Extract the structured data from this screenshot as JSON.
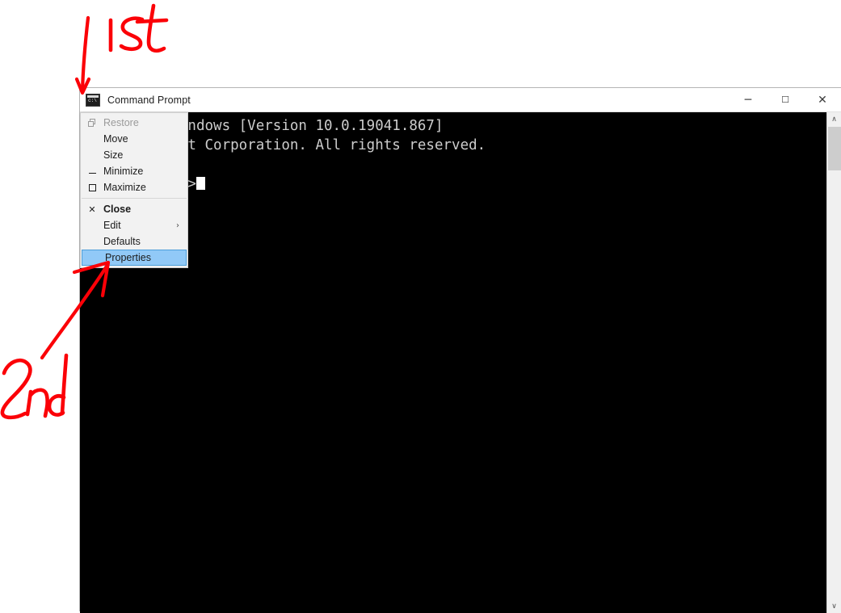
{
  "window": {
    "title": "Command Prompt",
    "app_icon": "command-prompt-icon",
    "caption_buttons": [
      {
        "name": "minimize",
        "glyph": "─"
      },
      {
        "name": "maximize",
        "glyph": "☐"
      },
      {
        "name": "close",
        "glyph": "✕"
      }
    ]
  },
  "console": {
    "lines": [
      "Microsoft Windows [Version 10.0.19041.867]",
      "(c) Microsoft Corporation. All rights reserved.",
      "",
      "C:\\Users\\edd>"
    ],
    "background_color": "#000000",
    "text_color": "#cccccc",
    "cursor": "block"
  },
  "scrollbar": {
    "up_arrow": "∧",
    "down_arrow": "∨"
  },
  "system_menu": {
    "items": [
      {
        "label": "Restore",
        "icon": "restore-icon",
        "disabled": true,
        "bold": false,
        "selected": false,
        "submenu": ""
      },
      {
        "label": "Move",
        "icon": "",
        "disabled": false,
        "bold": false,
        "selected": false,
        "submenu": ""
      },
      {
        "label": "Size",
        "icon": "",
        "disabled": false,
        "bold": false,
        "selected": false,
        "submenu": ""
      },
      {
        "label": "Minimize",
        "icon": "minimize-icon",
        "disabled": false,
        "bold": false,
        "selected": false,
        "submenu": ""
      },
      {
        "label": "Maximize",
        "icon": "maximize-icon",
        "disabled": false,
        "bold": false,
        "selected": false,
        "submenu": ""
      },
      {
        "label": "Close",
        "icon": "close-icon",
        "disabled": false,
        "bold": true,
        "selected": false,
        "submenu": ""
      },
      {
        "label": "Edit",
        "icon": "",
        "disabled": false,
        "bold": false,
        "selected": false,
        "submenu": "›"
      },
      {
        "label": "Defaults",
        "icon": "",
        "disabled": false,
        "bold": false,
        "selected": false,
        "submenu": ""
      },
      {
        "label": "Properties",
        "icon": "",
        "disabled": false,
        "bold": false,
        "selected": true,
        "submenu": ""
      }
    ],
    "separator_after_index": 4,
    "highlight_color": "#91c9f7",
    "highlight_border_color": "#4c9ed9"
  },
  "annotations": {
    "color": "#fb0007",
    "first": {
      "label": "1st",
      "points_to": "command-prompt-icon"
    },
    "second": {
      "label": "2nd",
      "points_to": "menu-item-properties"
    }
  }
}
